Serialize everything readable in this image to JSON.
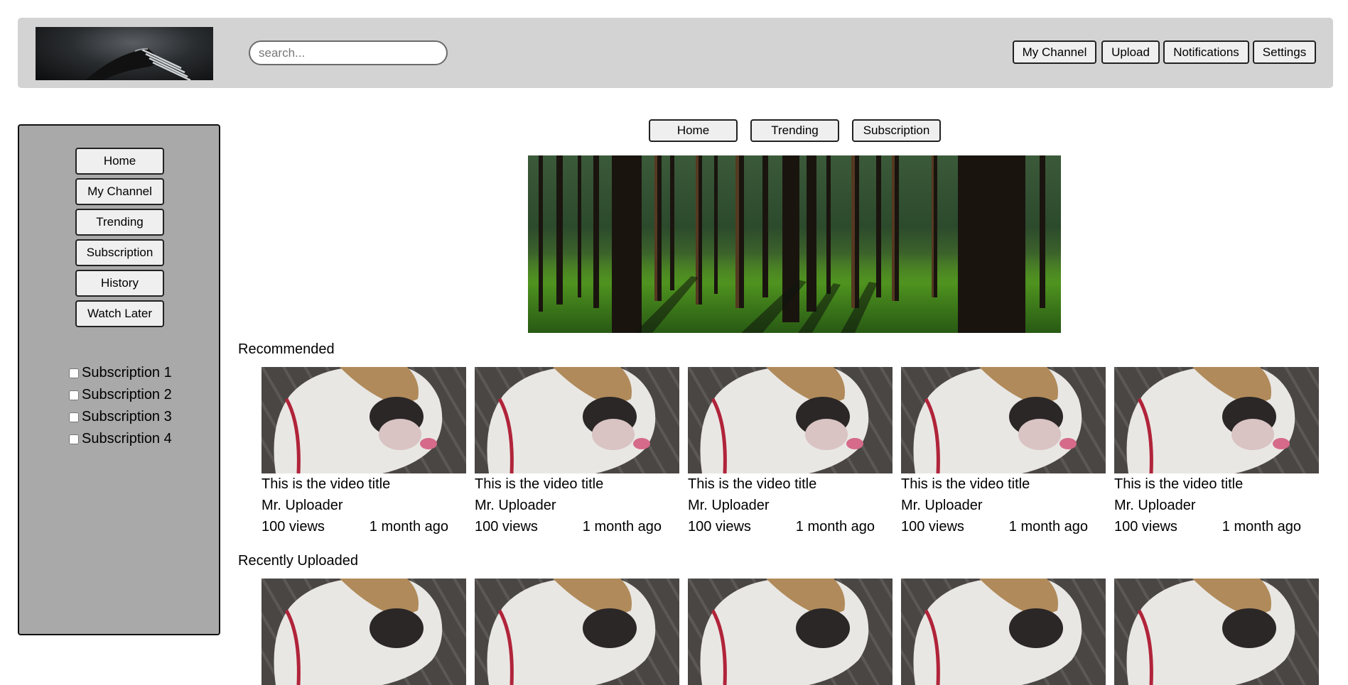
{
  "header": {
    "search_placeholder": "search...",
    "buttons": [
      "My Channel",
      "Upload",
      "Notifications",
      "Settings"
    ]
  },
  "sidebar": {
    "nav": [
      "Home",
      "My Channel",
      "Trending",
      "Subscription",
      "History",
      "Watch Later"
    ],
    "subscriptions": [
      "Subscription 1",
      "Subscription 2",
      "Subscription 3",
      "Subscription 4"
    ]
  },
  "tabs": [
    "Home",
    "Trending",
    "Subscription"
  ],
  "sections": {
    "recommended": "Recommended",
    "recent": "Recently Uploaded"
  },
  "video": {
    "title": "This is the video title",
    "uploader": "Mr. Uploader",
    "views": "100 views",
    "age": "1 month ago"
  }
}
